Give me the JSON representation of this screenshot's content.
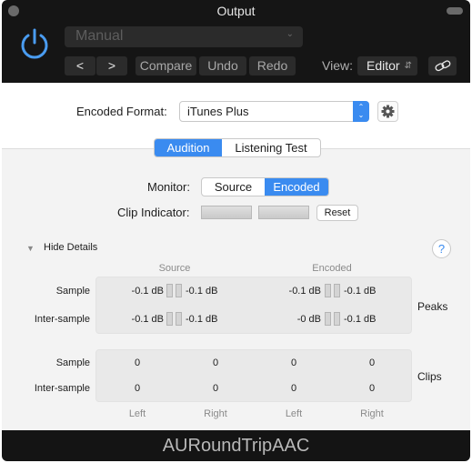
{
  "window": {
    "title": "Output",
    "footer_title": "AURoundTripAAC"
  },
  "header": {
    "preset": {
      "value": "Manual"
    },
    "buttons": {
      "back": "<",
      "forward": ">",
      "compare": "Compare",
      "undo": "Undo",
      "redo": "Redo"
    },
    "view": {
      "label": "View:",
      "value": "Editor"
    }
  },
  "encoded_format": {
    "label": "Encoded Format:",
    "value": "iTunes Plus"
  },
  "tabs": [
    {
      "label": "Audition",
      "selected": true
    },
    {
      "label": "Listening Test",
      "selected": false
    }
  ],
  "monitor": {
    "label": "Monitor:",
    "options": [
      {
        "label": "Source",
        "selected": false
      },
      {
        "label": "Encoded",
        "selected": true
      }
    ]
  },
  "clip_indicator": {
    "label": "Clip Indicator:",
    "reset_label": "Reset"
  },
  "details": {
    "toggle_label": "Hide Details",
    "help_label": "?",
    "columns": {
      "source": "Source",
      "encoded": "Encoded"
    },
    "peaks": {
      "label": "Peaks",
      "rows": [
        {
          "label": "Sample",
          "source_left": "-0.1 dB",
          "source_right": "-0.1 dB",
          "encoded_left": "-0.1 dB",
          "encoded_right": "-0.1 dB"
        },
        {
          "label": "Inter-sample",
          "source_left": "-0.1 dB",
          "source_right": "-0.1 dB",
          "encoded_left": "-0 dB",
          "encoded_right": "-0.1 dB"
        }
      ]
    },
    "clips": {
      "label": "Clips",
      "rows": [
        {
          "label": "Sample",
          "values": [
            "0",
            "0",
            "0",
            "0"
          ]
        },
        {
          "label": "Inter-sample",
          "values": [
            "0",
            "0",
            "0",
            "0"
          ]
        }
      ],
      "channel_labels": [
        "Left",
        "Right",
        "Left",
        "Right"
      ]
    }
  },
  "colors": {
    "accent": "#3a8bf0",
    "header_bg": "#151515",
    "panel_bg": "#f3f3f3"
  }
}
